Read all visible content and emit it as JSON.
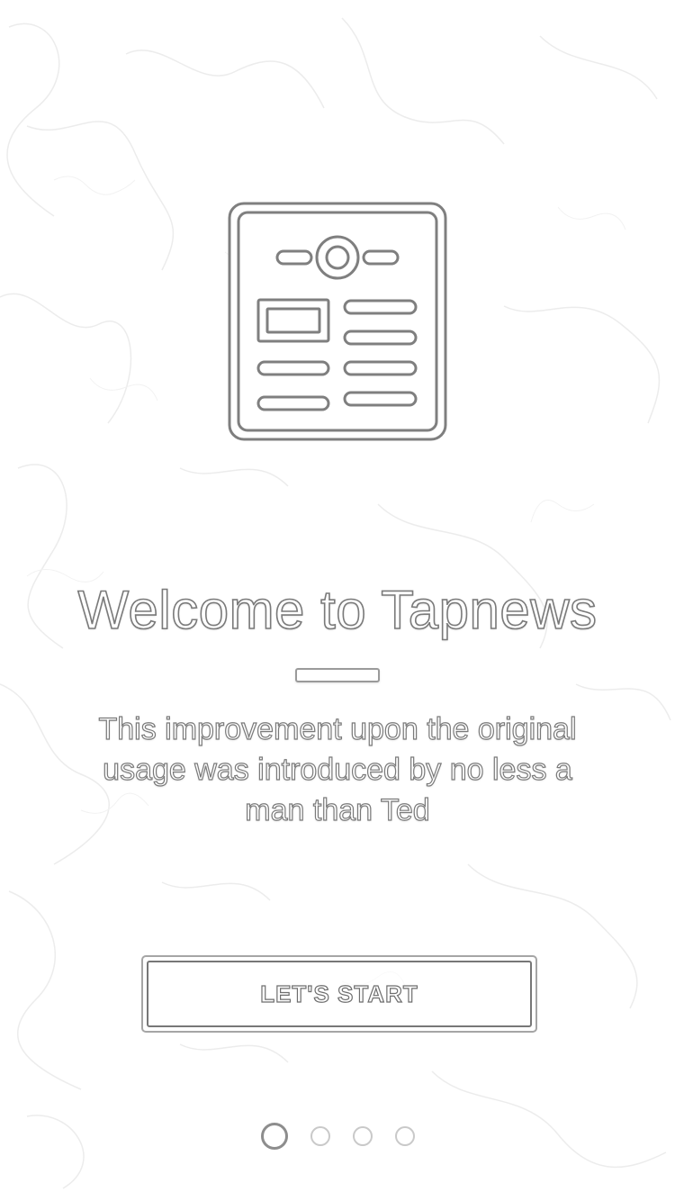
{
  "onboarding": {
    "title": "Welcome to Tapnews",
    "subtitle": "This improvement upon the original usage was introduced by no less a man than Ted",
    "start_button_label": "LET'S START",
    "hero_icon": "newspaper-icon"
  },
  "pager": {
    "pages": 4,
    "active_index": 0
  },
  "colors": {
    "background": "#ffffff",
    "outline": "#7a7a7a",
    "dot_inactive": "#c9c9c9",
    "dot_active": "#8d8d8d"
  }
}
